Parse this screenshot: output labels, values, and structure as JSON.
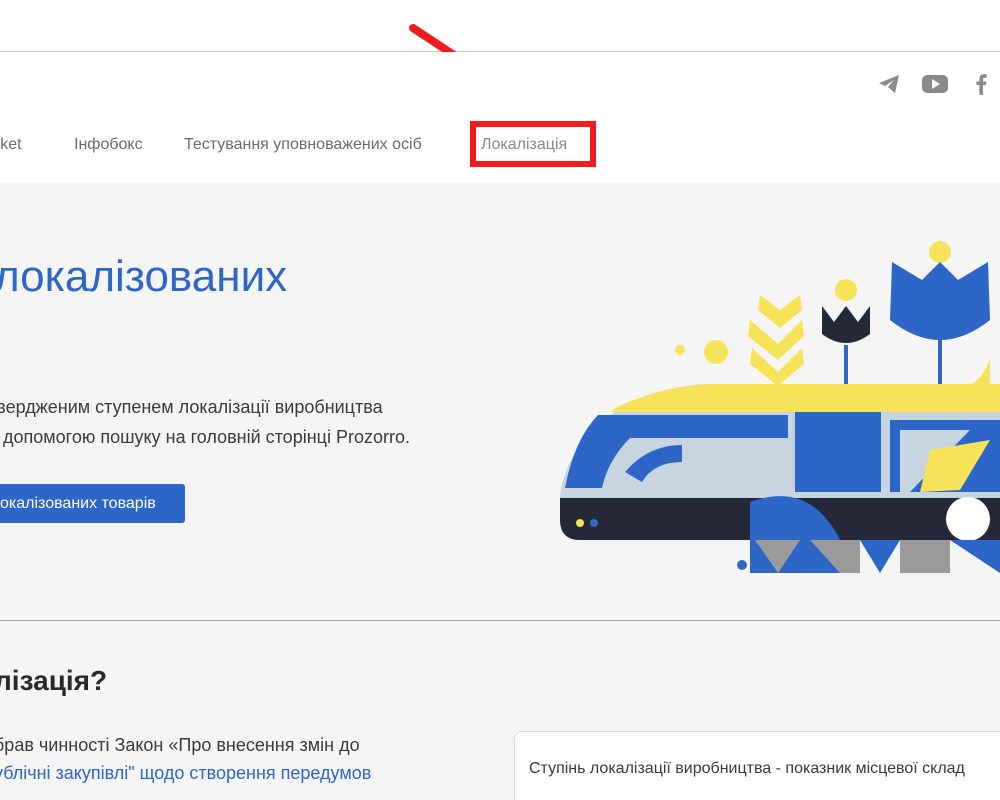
{
  "nav": {
    "items": [
      {
        "label": "arket"
      },
      {
        "label": "Інфобокс"
      },
      {
        "label": "Тестування уповноважених осіб"
      },
      {
        "label": "Локалізація"
      }
    ]
  },
  "socials": {
    "icons": [
      "telegram-icon",
      "youtube-icon",
      "facebook-icon"
    ]
  },
  "hero": {
    "title": "локалізованих",
    "text_line1": "твердженим ступенем локалізації виробництва",
    "text_line2": "а допомогою пошуку на головній сторінці Prozorro.",
    "button_label": "окалізованих товарів"
  },
  "section": {
    "title": "лізація?",
    "text_line1": "брав чинності Закон «Про внесення змін до",
    "text_line2": "ублічні закупівлі\" щодо створення передумов",
    "card_text": "Ступінь локалізації виробництва - показник місцевої склад"
  },
  "colors": {
    "accent": "#2d66c6",
    "annotation": "#f21b1b",
    "yellow": "#f7e35a",
    "navy": "#252839"
  }
}
